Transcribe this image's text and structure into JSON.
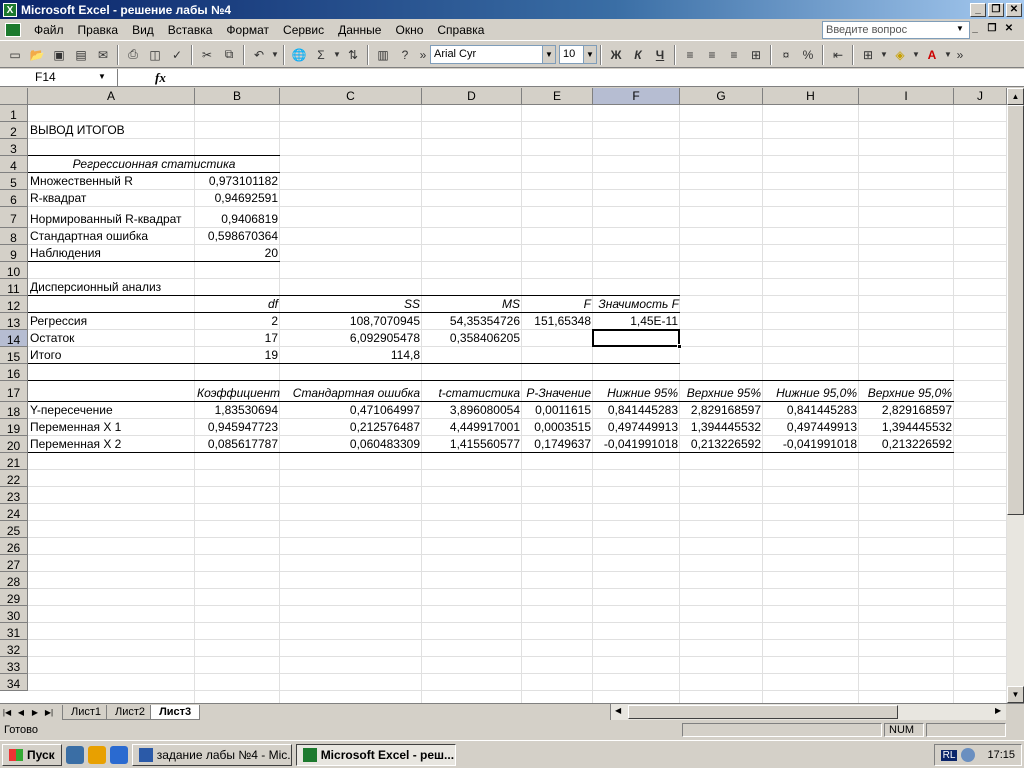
{
  "window": {
    "title": "Microsoft Excel - решение лабы №4",
    "icon": "excel-icon"
  },
  "menu": {
    "items": [
      "Файл",
      "Правка",
      "Вид",
      "Вставка",
      "Формат",
      "Сервис",
      "Данные",
      "Окно",
      "Справка"
    ],
    "help_placeholder": "Введите вопрос"
  },
  "toolbar": {
    "font": "Arial Cyr",
    "size": "10",
    "bold": "Ж",
    "italic": "К",
    "underline": "Ч",
    "sigma": "Σ",
    "percent": "%"
  },
  "formula": {
    "namebox": "F14",
    "fx": "fx",
    "content": ""
  },
  "columns": [
    "A",
    "B",
    "C",
    "D",
    "E",
    "F",
    "G",
    "H",
    "I",
    "J"
  ],
  "rows": [
    "1",
    "2",
    "3",
    "4",
    "5",
    "6",
    "7",
    "8",
    "9",
    "10",
    "11",
    "12",
    "13",
    "14",
    "15",
    "16",
    "17",
    "18",
    "19",
    "20",
    "21",
    "22",
    "23",
    "24",
    "25",
    "26",
    "27",
    "28",
    "29",
    "30",
    "31",
    "32",
    "33",
    "34"
  ],
  "selected": {
    "column": "F",
    "row": "14"
  },
  "sheet": {
    "r2": {
      "a": "ВЫВОД ИТОГОВ"
    },
    "r4": {
      "a": "Регрессионная статистика"
    },
    "r5": {
      "a": "Множественный R",
      "b": "0,973101182"
    },
    "r6": {
      "a": "R-квадрат",
      "b": "0,94692591"
    },
    "r7": {
      "a": "Нормированный R-квадрат",
      "b": "0,9406819"
    },
    "r8": {
      "a": "Стандартная ошибка",
      "b": "0,598670364"
    },
    "r9": {
      "a": "Наблюдения",
      "b": "20"
    },
    "r11": {
      "a": "Дисперсионный анализ"
    },
    "r12": {
      "b": "df",
      "c": "SS",
      "d": "MS",
      "e": "F",
      "f": "Значимость F"
    },
    "r13": {
      "a": "Регрессия",
      "b": "2",
      "c": "108,7070945",
      "d": "54,35354726",
      "e": "151,65348",
      "f": "1,45E-11"
    },
    "r14": {
      "a": "Остаток",
      "b": "17",
      "c": "6,092905478",
      "d": "0,358406205"
    },
    "r15": {
      "a": "Итого",
      "b": "19",
      "c": "114,8"
    },
    "r17": {
      "b": "Коэффициенты",
      "c": "Стандартная ошибка",
      "d": "t-статистика",
      "e": "P-Значение",
      "f": "Нижние 95%",
      "g": "Верхние 95%",
      "h": "Нижние 95,0%",
      "i": "Верхние 95,0%"
    },
    "r18": {
      "a": "Y-пересечение",
      "b": "1,83530694",
      "c": "0,471064997",
      "d": "3,896080054",
      "e": "0,0011615",
      "f": "0,841445283",
      "g": "2,829168597",
      "h": "0,841445283",
      "i": "2,829168597"
    },
    "r19": {
      "a": "Переменная X 1",
      "b": "0,945947723",
      "c": "0,212576487",
      "d": "4,449917001",
      "e": "0,0003515",
      "f": "0,497449913",
      "g": "1,394445532",
      "h": "0,497449913",
      "i": "1,394445532"
    },
    "r20": {
      "a": "Переменная X 2",
      "b": "0,085617787",
      "c": "0,060483309",
      "d": "1,415560577",
      "e": "0,1749637",
      "f": "-0,041991018",
      "g": "0,213226592",
      "h": "-0,041991018",
      "i": "0,213226592"
    }
  },
  "tabs": [
    "Лист1",
    "Лист2",
    "Лист3"
  ],
  "active_tab": "Лист3",
  "status": {
    "ready": "Готово",
    "num": "NUM"
  },
  "taskbar": {
    "start": "Пуск",
    "task1": "задание лабы №4 - Mic...",
    "task2": "Microsoft Excel - реш...",
    "lang": "RL",
    "clock": "17:15"
  }
}
